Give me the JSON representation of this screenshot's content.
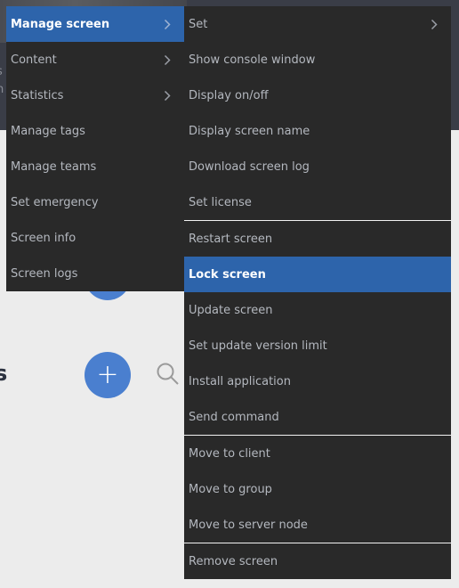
{
  "background": {
    "header_ghost_text": [
      "s x",
      "n"
    ],
    "title_fragment": "s",
    "add_button_label": "+",
    "colors": {
      "page_bg": "#ececec",
      "header_bg": "#3a3d47",
      "menu_bg": "#292929",
      "highlight": "#2d64ab",
      "fab": "#4a7fcf"
    }
  },
  "context_menu": {
    "items": [
      {
        "label": "Manage screen",
        "has_submenu": true,
        "active": true
      },
      {
        "label": "Content",
        "has_submenu": true,
        "active": false
      },
      {
        "label": "Statistics",
        "has_submenu": true,
        "active": false
      },
      {
        "label": "Manage tags",
        "has_submenu": false,
        "active": false
      },
      {
        "label": "Manage teams",
        "has_submenu": false,
        "active": false
      },
      {
        "label": "Set emergency",
        "has_submenu": false,
        "active": false
      },
      {
        "label": "Screen info",
        "has_submenu": false,
        "active": false
      },
      {
        "label": "Screen logs",
        "has_submenu": false,
        "active": false
      }
    ]
  },
  "submenu": {
    "groups": [
      [
        {
          "label": "Set",
          "has_submenu": true
        },
        {
          "label": "Show console window"
        },
        {
          "label": "Display on/off"
        },
        {
          "label": "Display screen name"
        },
        {
          "label": "Download screen log"
        },
        {
          "label": "Set license"
        }
      ],
      [
        {
          "label": "Restart screen"
        },
        {
          "label": "Lock screen",
          "active": true
        },
        {
          "label": "Update screen"
        },
        {
          "label": "Set update version limit"
        },
        {
          "label": "Install application"
        },
        {
          "label": "Send command"
        }
      ],
      [
        {
          "label": "Move to client"
        },
        {
          "label": "Move to group"
        },
        {
          "label": "Move to server node"
        }
      ],
      [
        {
          "label": "Remove screen"
        }
      ]
    ]
  }
}
